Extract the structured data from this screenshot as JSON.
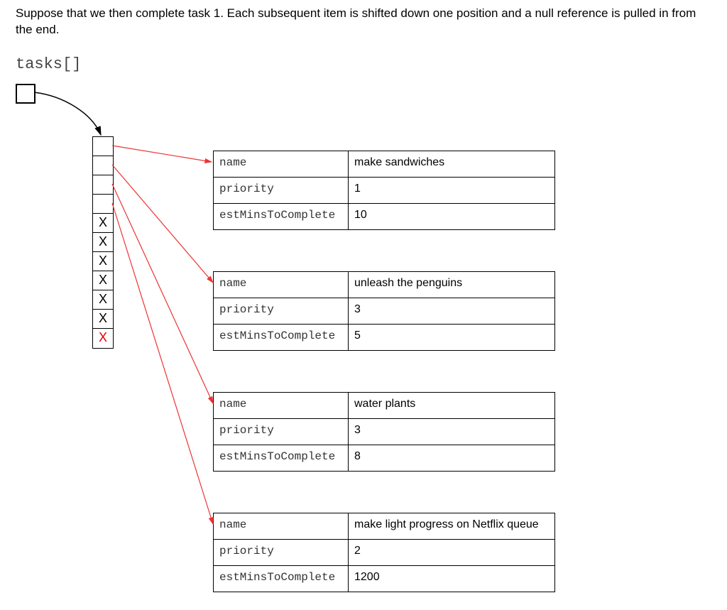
{
  "intro": "Suppose that we then complete task 1. Each subsequent item is shifted down one position and a null reference is pulled in from the end.",
  "array_label": "tasks[]",
  "field_labels": {
    "name": "name",
    "priority": "priority",
    "est": "estMinsToComplete"
  },
  "array_cells": [
    "",
    "",
    "",
    "",
    "X",
    "X",
    "X",
    "X",
    "X",
    "X",
    "X"
  ],
  "tasks": [
    {
      "name": "make sandwiches",
      "priority": "1",
      "est": "10"
    },
    {
      "name": "unleash the penguins",
      "priority": "3",
      "est": "5"
    },
    {
      "name": "water plants",
      "priority": "3",
      "est": "8"
    },
    {
      "name": "make light progress on Netflix queue",
      "priority": "2",
      "est": "1200"
    }
  ],
  "chart_data": {
    "type": "table",
    "description": "Array of task objects after removing task 1 and shifting. Four slots hold references to task objects; remaining seven slots are null (X). Red X marks the newly-nulled trailing slot.",
    "array_length": 11,
    "populated_indices": [
      0,
      1,
      2,
      3
    ],
    "null_indices": [
      4,
      5,
      6,
      7,
      8,
      9,
      10
    ],
    "newly_null_index": 10,
    "objects": [
      {
        "index": 0,
        "name": "make sandwiches",
        "priority": 1,
        "estMinsToComplete": 10
      },
      {
        "index": 1,
        "name": "unleash the penguins",
        "priority": 3,
        "estMinsToComplete": 5
      },
      {
        "index": 2,
        "name": "water plants",
        "priority": 3,
        "estMinsToComplete": 8
      },
      {
        "index": 3,
        "name": "make light progress on Netflix queue",
        "priority": 2,
        "estMinsToComplete": 1200
      }
    ]
  }
}
